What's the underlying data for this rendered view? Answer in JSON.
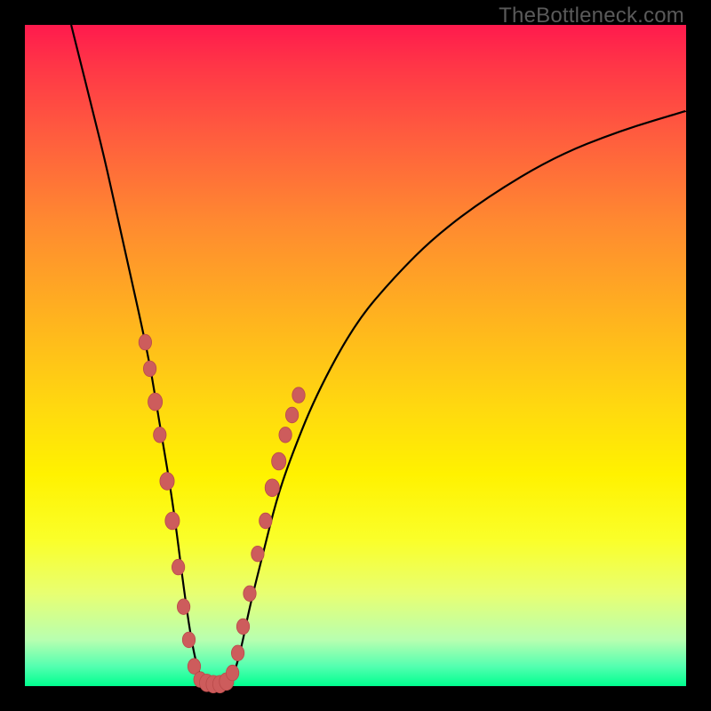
{
  "watermark": "TheBottleneck.com",
  "colors": {
    "background_frame": "#000000",
    "gradient_top": "#ff1a4d",
    "gradient_bottom": "#00ff8f",
    "curve": "#000000",
    "beads": "#cd5c5c"
  },
  "chart_data": {
    "type": "line",
    "title": "",
    "xlabel": "",
    "ylabel": "",
    "xlim": [
      0,
      100
    ],
    "ylim": [
      0,
      100
    ],
    "series": [
      {
        "name": "v-curve",
        "x": [
          7,
          8,
          10,
          12,
          14,
          16,
          18,
          19,
          20,
          21,
          22,
          23,
          24,
          25,
          26,
          27,
          28,
          29,
          30,
          31,
          32,
          33,
          34,
          36,
          38,
          40,
          44,
          50,
          56,
          62,
          70,
          80,
          90,
          100
        ],
        "y": [
          100,
          96,
          88,
          80,
          71,
          62,
          53,
          48,
          42,
          36,
          30,
          23,
          15,
          8,
          3,
          0.5,
          0,
          0,
          0,
          0.5,
          3,
          7,
          12,
          20,
          28,
          34,
          44,
          55,
          62,
          68,
          74,
          80,
          84,
          87
        ]
      }
    ],
    "markers": {
      "name": "beads",
      "points": [
        {
          "x": 18.2,
          "y": 52,
          "r": 8
        },
        {
          "x": 18.9,
          "y": 48,
          "r": 8
        },
        {
          "x": 19.7,
          "y": 43,
          "r": 9
        },
        {
          "x": 20.4,
          "y": 38,
          "r": 8
        },
        {
          "x": 21.5,
          "y": 31,
          "r": 9
        },
        {
          "x": 22.3,
          "y": 25,
          "r": 9
        },
        {
          "x": 23.2,
          "y": 18,
          "r": 8
        },
        {
          "x": 24.0,
          "y": 12,
          "r": 8
        },
        {
          "x": 24.8,
          "y": 7,
          "r": 8
        },
        {
          "x": 25.6,
          "y": 3,
          "r": 8
        },
        {
          "x": 26.5,
          "y": 1,
          "r": 8
        },
        {
          "x": 27.5,
          "y": 0.5,
          "r": 9
        },
        {
          "x": 28.5,
          "y": 0.3,
          "r": 9
        },
        {
          "x": 29.5,
          "y": 0.3,
          "r": 9
        },
        {
          "x": 30.5,
          "y": 0.7,
          "r": 9
        },
        {
          "x": 31.4,
          "y": 2,
          "r": 8
        },
        {
          "x": 32.2,
          "y": 5,
          "r": 8
        },
        {
          "x": 33.0,
          "y": 9,
          "r": 8
        },
        {
          "x": 34.0,
          "y": 14,
          "r": 8
        },
        {
          "x": 35.2,
          "y": 20,
          "r": 8
        },
        {
          "x": 36.4,
          "y": 25,
          "r": 8
        },
        {
          "x": 37.4,
          "y": 30,
          "r": 9
        },
        {
          "x": 38.4,
          "y": 34,
          "r": 9
        },
        {
          "x": 39.4,
          "y": 38,
          "r": 8
        },
        {
          "x": 40.4,
          "y": 41,
          "r": 8
        },
        {
          "x": 41.4,
          "y": 44,
          "r": 8
        }
      ]
    }
  }
}
